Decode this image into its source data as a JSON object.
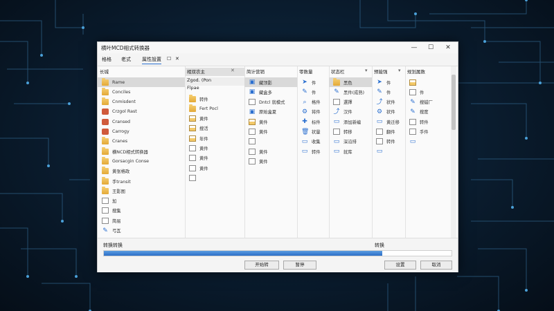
{
  "window": {
    "title": "横叶MCD相式转换器",
    "controls": {
      "minimize": "—",
      "maximize": "☐",
      "close": "✕"
    }
  },
  "menubar": {
    "items": [
      {
        "label": "格格"
      },
      {
        "label": "老式"
      },
      {
        "label": "属性設置",
        "active": true
      },
      {
        "label": "☐"
      },
      {
        "label": "✕"
      }
    ]
  },
  "columns": {
    "col1": {
      "header": "长城",
      "rows": [
        {
          "label": "Rame",
          "icon": "folder-icon",
          "selected": true
        },
        {
          "label": "Conciles",
          "icon": "folder-icon"
        },
        {
          "label": "Cnmisdent",
          "icon": "folder-icon"
        },
        {
          "label": "Crzgol Rast",
          "icon": "red-file-icon"
        },
        {
          "label": "Cransed",
          "icon": "red-file-icon"
        },
        {
          "label": "Carrogy",
          "icon": "red-file-icon"
        },
        {
          "label": "Cranes",
          "icon": "folder-icon"
        },
        {
          "label": "横NCD相式转换器",
          "icon": "folder-icon"
        },
        {
          "label": "Gorsacgin Conse",
          "icon": "folder-icon"
        },
        {
          "label": "黄张格政",
          "icon": "folder-icon"
        },
        {
          "label": "手transit",
          "icon": "folder-icon"
        },
        {
          "label": "王影图",
          "icon": "folder-icon"
        },
        {
          "label": "加",
          "icon": "doc-icon"
        },
        {
          "label": "搜集",
          "icon": "doc-icon"
        },
        {
          "label": "简易",
          "icon": "doc-icon"
        },
        {
          "label": "弓瓦",
          "icon": "pen-icon"
        }
      ]
    },
    "col2": {
      "header": "相双农主",
      "subheader": "Zgod. (Pon",
      "subheader2": "Flpae",
      "sort": "✕",
      "rows": [
        {
          "label": "转件",
          "icon": "folder-icon"
        },
        {
          "label": "Fert Pocl",
          "icon": "folder-icon"
        },
        {
          "label": "黄件",
          "icon": "doc-folder-icon"
        },
        {
          "label": "搜活",
          "icon": "doc-folder-icon"
        },
        {
          "label": "年件",
          "icon": "doc-folder-icon"
        },
        {
          "label": "黄件",
          "icon": "doc-icon"
        },
        {
          "label": "黄件",
          "icon": "doc-icon"
        },
        {
          "label": "黄件",
          "icon": "doc-icon"
        },
        {
          "label": "",
          "icon": "doc-icon"
        }
      ]
    },
    "col3": {
      "header": "简计营销",
      "rows": [
        {
          "label": "藏顶影",
          "icon": "image-icon",
          "selected": true
        },
        {
          "label": "藏盒多",
          "icon": "image-icon"
        },
        {
          "label": "Dntcl 就模式",
          "icon": "doc-icon"
        },
        {
          "label": "原始盒夏",
          "icon": "image-icon"
        },
        {
          "label": "黄件",
          "icon": "doc-folder-icon"
        },
        {
          "label": "黄件",
          "icon": "doc-icon"
        },
        {
          "label": "",
          "icon": "doc-icon"
        },
        {
          "label": "黄件",
          "icon": "doc-icon"
        },
        {
          "label": "黄件",
          "icon": "doc-icon"
        }
      ]
    },
    "col4": {
      "header": "零数量",
      "sort": "▾",
      "rows": [
        {
          "label": "件",
          "icon": "pointer-icon"
        },
        {
          "label": "件",
          "icon": "pen-icon"
        },
        {
          "label": "格件",
          "icon": "search-icon"
        },
        {
          "label": "将件",
          "icon": "gear-icon"
        },
        {
          "label": "标件",
          "icon": "plus-icon"
        },
        {
          "label": "状量",
          "icon": "trash-icon"
        },
        {
          "label": "收集",
          "icon": "monitor-icon"
        },
        {
          "label": "转件",
          "icon": "monitor-icon"
        }
      ]
    },
    "col5": {
      "header": "状态栏",
      "sort": "▾",
      "rows": [
        {
          "label": "黑色",
          "icon": "folder-icon",
          "selected": true
        },
        {
          "label": "黑件(成熟)",
          "icon": "pen-icon"
        },
        {
          "label": "選擇",
          "icon": "doc-icon"
        },
        {
          "label": "汉件",
          "icon": "share-icon"
        },
        {
          "label": "添加新编",
          "icon": "monitor-icon"
        },
        {
          "label": "转移",
          "icon": "doc-icon"
        },
        {
          "label": "深沿排",
          "icon": "monitor-icon"
        },
        {
          "label": "就库",
          "icon": "monitor-icon"
        }
      ]
    },
    "col6": {
      "header": "预能强",
      "sort": "▾",
      "rows": [
        {
          "label": "件",
          "icon": "pointer-icon"
        },
        {
          "label": "件",
          "icon": "pen-icon"
        },
        {
          "label": "状件",
          "icon": "share-icon"
        },
        {
          "label": "状件",
          "icon": "gear-icon"
        },
        {
          "label": "黄迁移",
          "icon": "monitor-icon"
        },
        {
          "label": "翻件",
          "icon": "doc-icon"
        },
        {
          "label": "转件",
          "icon": "doc-icon"
        },
        {
          "label": "",
          "icon": "monitor-icon"
        }
      ]
    },
    "col7": {
      "header": "规划属数",
      "rows": [
        {
          "label": "",
          "icon": "doc-folder-icon"
        },
        {
          "label": "件",
          "icon": "doc-icon"
        },
        {
          "label": "搜蜡厂",
          "icon": "pen-icon"
        },
        {
          "label": "搜度",
          "icon": "pen-icon"
        },
        {
          "label": "转件",
          "icon": "doc-icon"
        },
        {
          "label": "手件",
          "icon": "doc-icon"
        },
        {
          "label": "",
          "icon": "monitor-icon"
        }
      ]
    }
  },
  "progress": {
    "label": "转换转换",
    "right_label": "转换",
    "value": 0.8,
    "color": "#2c6fc7"
  },
  "buttons": {
    "start": "开始转",
    "pause": "暂停",
    "settings": "设置",
    "cancel": "取消"
  }
}
